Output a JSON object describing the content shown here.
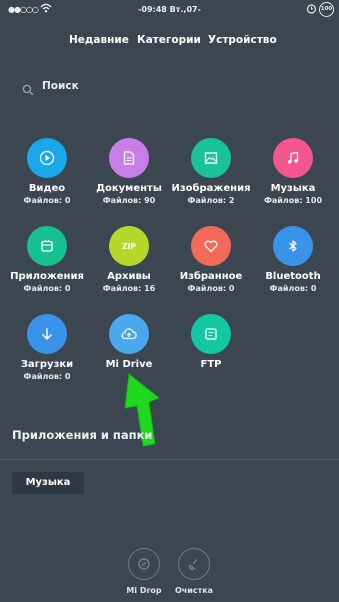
{
  "status_bar": {
    "time": "-09:48 Вт.,07-",
    "battery": "100"
  },
  "tabs": [
    {
      "label": "Недавние"
    },
    {
      "label": "Категории"
    },
    {
      "label": "Устройство"
    }
  ],
  "search": {
    "label": "Поиск"
  },
  "categories": [
    {
      "name": "Видео",
      "count": "Файлов: 0",
      "icon": "play-icon",
      "color": "#1aa8e8"
    },
    {
      "name": "Документы",
      "count": "Файлов: 90",
      "icon": "document-icon",
      "color": "#c77ee6"
    },
    {
      "name": "Изображения",
      "count": "Файлов: 2",
      "icon": "image-icon",
      "color": "#18c29a"
    },
    {
      "name": "Музыка",
      "count": "Файлов: 100",
      "icon": "music-icon",
      "color": "#f4568d"
    },
    {
      "name": "Приложения",
      "count": "Файлов: 0",
      "icon": "app-icon",
      "color": "#15c18f"
    },
    {
      "name": "Архивы",
      "count": "Файлов: 16",
      "icon": "zip-icon",
      "color": "#b6d82b"
    },
    {
      "name": "Избранное",
      "count": "Файлов: 0",
      "icon": "heart-icon",
      "color": "#f36b57"
    },
    {
      "name": "Bluetooth",
      "count": "Файлов: 0",
      "icon": "bluetooth-icon",
      "color": "#3a93ea"
    },
    {
      "name": "Загрузки",
      "count": "Файлов: 0",
      "icon": "download-icon",
      "color": "#3a93ea"
    },
    {
      "name": "Mi Drive",
      "count": "",
      "icon": "cloud-icon",
      "color": "#4aa8ee"
    },
    {
      "name": "FTP",
      "count": "",
      "icon": "ftp-icon",
      "color": "#12c9a4"
    }
  ],
  "section": {
    "title": "Приложения и папки"
  },
  "folders": [
    {
      "label": "Музыка"
    }
  ],
  "bottom_actions": [
    {
      "label": "Mi Drop",
      "icon": "mi-drop-icon"
    },
    {
      "label": "Очистка",
      "icon": "cleaner-icon"
    }
  ]
}
